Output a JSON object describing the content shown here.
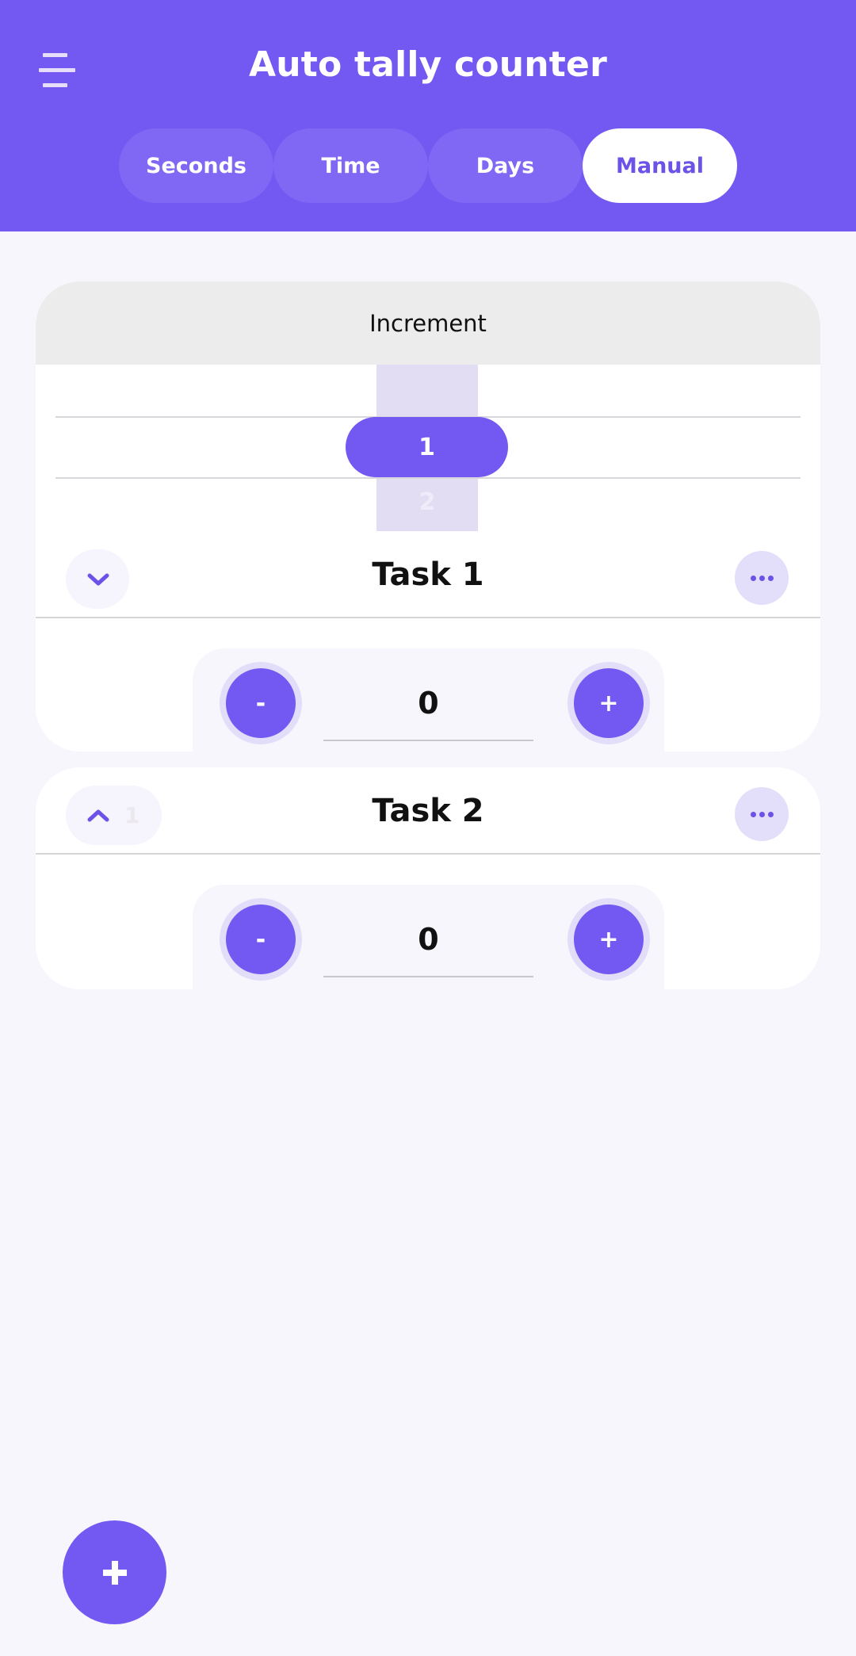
{
  "header": {
    "title": "Auto tally counter",
    "menu_icon": "hamburger-menu-icon"
  },
  "tabs": [
    {
      "label": "Seconds",
      "active": false
    },
    {
      "label": "Time",
      "active": false
    },
    {
      "label": "Days",
      "active": false
    },
    {
      "label": "Manual",
      "active": true
    }
  ],
  "increment_picker": {
    "label": "Increment",
    "selected": "1",
    "next": "2"
  },
  "tasks": [
    {
      "name": "Task 1",
      "expanded": true,
      "toggle_icon": "chevron-down-icon",
      "collapsed_count": "",
      "value": "0",
      "minus_label": "-",
      "plus_label": "+",
      "more_icon": "more-horizontal-icon"
    },
    {
      "name": "Task 2",
      "expanded": false,
      "toggle_icon": "chevron-up-icon",
      "collapsed_count": "1",
      "value": "0",
      "minus_label": "-",
      "plus_label": "+",
      "more_icon": "more-horizontal-icon"
    }
  ],
  "fab": {
    "icon": "plus-icon",
    "action": "add-task"
  },
  "colors": {
    "accent": "#7358f2",
    "tab_inactive": "#8068f4",
    "background": "#f7f6fd",
    "picker_column": "#e2ddf3",
    "more_button_bg": "#e3defa"
  }
}
